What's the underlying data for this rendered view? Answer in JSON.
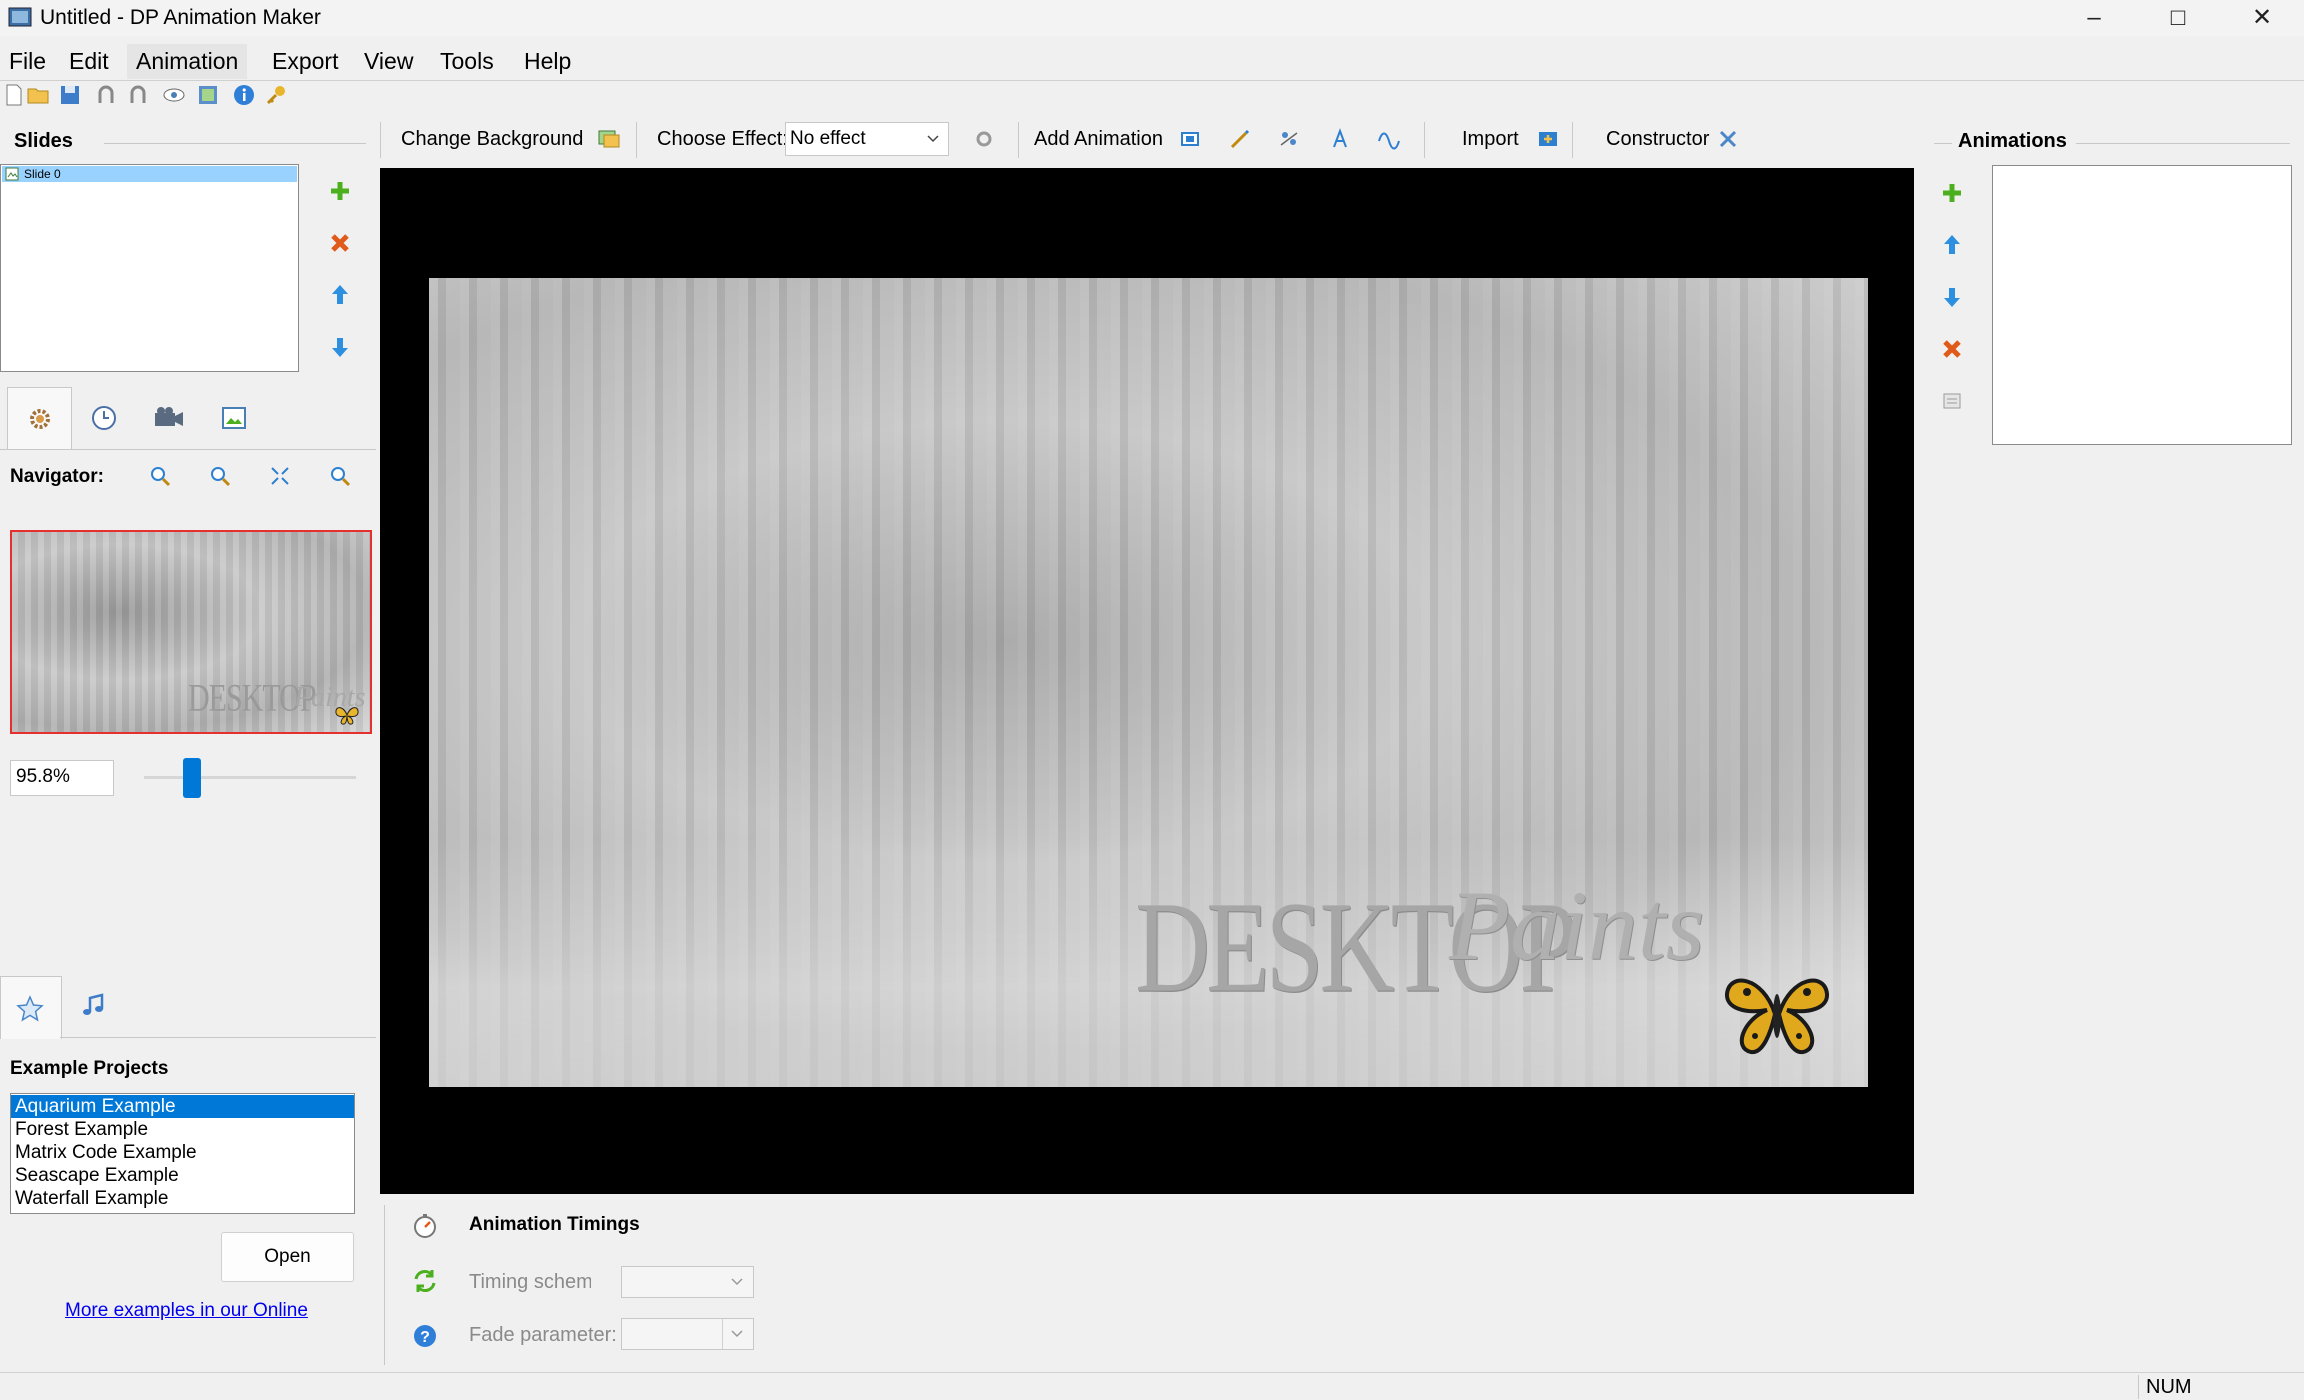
{
  "window": {
    "title": "Untitled - DP Animation Maker"
  },
  "menu": [
    "File",
    "Edit",
    "Animation",
    "Export",
    "View",
    "Tools",
    "Help"
  ],
  "toolbar": {
    "change_background": "Change Background",
    "choose_effect_label": "Choose Effect:",
    "effect_value": "No effect",
    "add_animation": "Add Animation",
    "import": "Import",
    "constructor": "Constructor"
  },
  "slides": {
    "title": "Slides",
    "items": [
      "Slide 0"
    ]
  },
  "navigator": {
    "label": "Navigator:",
    "zoom_value": "95.8%",
    "zoom_slider_fraction": 0.2
  },
  "canvas": {
    "watermark_word1": "DESKTOP",
    "watermark_word2": "Paints"
  },
  "animations": {
    "title": "Animations"
  },
  "examples": {
    "title": "Example Projects",
    "items": [
      "Aquarium Example",
      "Forest Example",
      "Matrix Code Example",
      "Seascape Example",
      "Waterfall Example"
    ],
    "selected_index": 0,
    "open_button": "Open",
    "more_link": "More examples in our Online"
  },
  "timings": {
    "title": "Animation Timings",
    "timing_scheme_label": "Timing scheme",
    "fade_parameter_label": "Fade parameter:"
  },
  "status": {
    "num": "NUM"
  },
  "colors": {
    "accent": "#0078d7",
    "canvas_bg": "#000000",
    "link": "#0000ee",
    "add": "#4caf1e",
    "remove": "#e05a1a",
    "arrow": "#2d8fe0"
  }
}
